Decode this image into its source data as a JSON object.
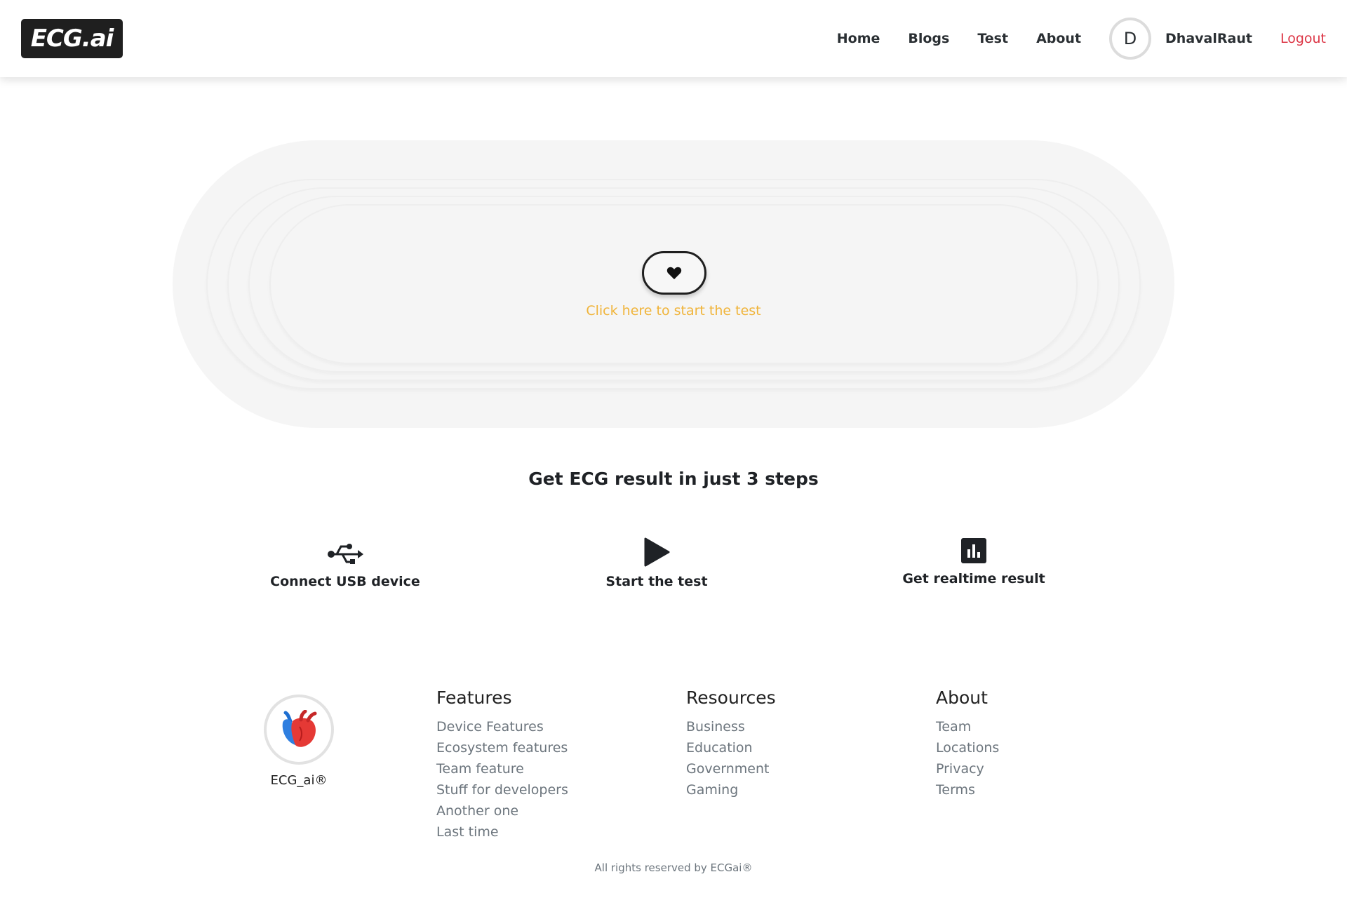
{
  "navbar": {
    "brand": "ECG.ai",
    "links": [
      "Home",
      "Blogs",
      "Test",
      "About"
    ],
    "avatar_initial": "D",
    "username": "DhavalRaut",
    "logout": "Logout"
  },
  "hero": {
    "start_icon": "heart-icon",
    "start_text": "Click here to start the test"
  },
  "steps": {
    "title": "Get ECG result in just 3 steps",
    "items": [
      {
        "icon": "usb-icon",
        "label": "Connect USB device"
      },
      {
        "icon": "play-icon",
        "label": "Start the test"
      },
      {
        "icon": "bar-chart-icon",
        "label": "Get realtime result"
      }
    ]
  },
  "footer": {
    "logo_icon": "anatomical-heart-icon",
    "brand": "ECG_ai®",
    "columns": [
      {
        "title": "Features",
        "links": [
          "Device Features",
          "Ecosystem features",
          "Team feature",
          "Stuff for developers",
          "Another one",
          "Last time"
        ]
      },
      {
        "title": "Resources",
        "links": [
          "Business",
          "Education",
          "Government",
          "Gaming"
        ]
      },
      {
        "title": "About",
        "links": [
          "Team",
          "Locations",
          "Privacy",
          "Terms"
        ]
      }
    ],
    "copyright": "All rights reserved by ECGai®"
  },
  "colors": {
    "accent_text": "#f0b43a",
    "logout": "#dc3545",
    "muted": "#6c757d",
    "dark": "#1f1f1f"
  }
}
